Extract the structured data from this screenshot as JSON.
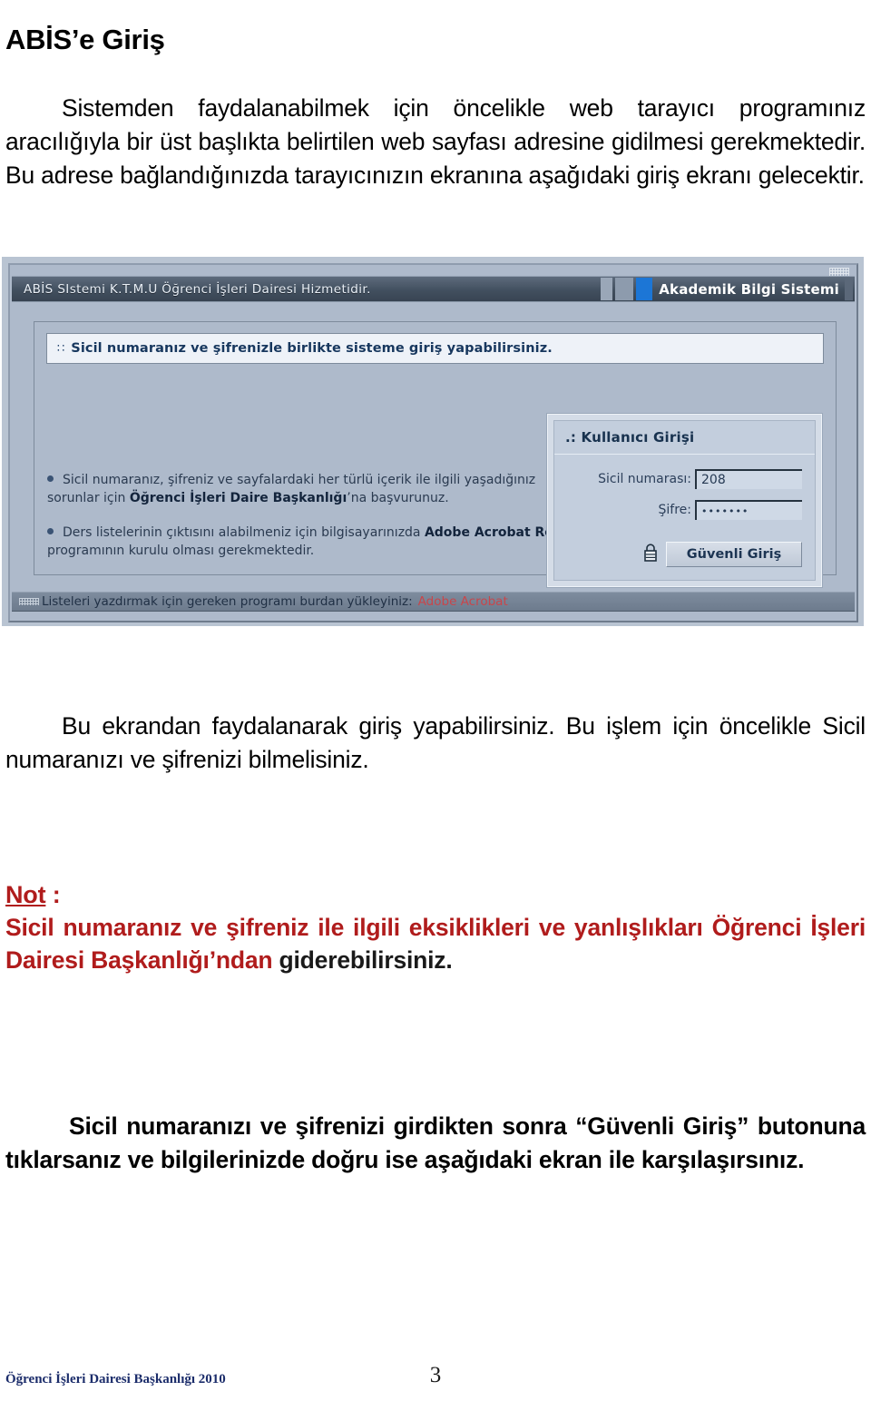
{
  "document": {
    "title": "ABİS’e Giriş",
    "intro_paragraph": "Sistemden faydalanabilmek için öncelikle web tarayıcı programınız aracılığıyla bir üst başlıkta belirtilen web sayfası adresine gidilmesi gerekmektedir. Bu adrese bağlandığınızda tarayıcınızın ekranına aşağıdaki giriş ekranı gelecektir.",
    "after_screenshot_paragraph": "Bu ekrandan faydalanarak giriş yapabilirsiniz. Bu işlem için öncelikle Sicil numaranızı ve şifrenizi bilmelisiniz.",
    "note": {
      "label": "Not",
      "label_suffix": " :",
      "line_red": "Sicil numaranız ve şifreniz ile ilgili eksiklikleri ve yanlışlıkları Öğrenci İşleri Dairesi Başkanlığı’ndan ",
      "line_dark": "giderebilirsiniz."
    },
    "closing_paragraph": "Sicil numaranızı ve şifrenizi girdikten sonra “Güvenli Giriş” butonuna tıklarsanız ve bilgilerinizde doğru ise aşağıdaki ekran ile karşılaşırsınız.",
    "footer": {
      "department": "Öğrenci İşleri Dairesi Başkanlığı 2010",
      "page_number": "3"
    }
  },
  "screenshot": {
    "titlebar": {
      "text": "ABİS SIstemi K.T.M.U Öğrenci İşleri Dairesi Hizmetidir.",
      "brand": "Akademik Bilgi Sistemi"
    },
    "notice": {
      "bullet": "∷",
      "text": "Sicil numaranız ve şifrenizle birlikte sisteme giriş yapabilirsiniz."
    },
    "info_items": [
      {
        "pre": "Sicil numaranız, şifreniz ve sayfalardaki her türlü içerik ile ilgili yaşadığınız sorunlar için ",
        "bold": "Öğrenci İşleri Daire Başkanlığı",
        "post": "’na başvurunuz."
      },
      {
        "pre": "Ders listelerinin çıktısını alabilmeniz için bilgisayarınızda ",
        "bold": "Adobe Acrobat Reader",
        "post": " programının kurulu olması gerekmektedir."
      }
    ],
    "login": {
      "title": ".: Kullanıcı Girişi",
      "sicil_label": "Sicil numarası:",
      "sicil_value": "208",
      "sifre_label": "Şifre:",
      "sifre_value": "•••••••",
      "submit_label": "Güvenli Giriş"
    },
    "app_footer": {
      "text": "Listeleri yazdırmak için gereken programı burdan yükleyiniz:",
      "link": "Adobe Acrobat"
    }
  },
  "colors": {
    "note_red": "#b01c1c",
    "footer_navy": "#1c2d6b",
    "link_red": "#c8464b",
    "titlebar_brand_blue": "#1c76d6"
  }
}
